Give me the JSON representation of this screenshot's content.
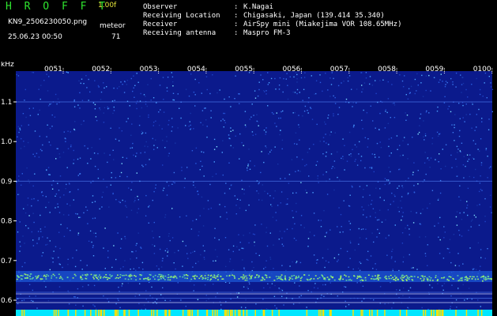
{
  "header": {
    "app_title": "H R O F F T",
    "version": "1.00f",
    "filename": "KN9_2506230050.png",
    "datetime": "25.06.23 00:50",
    "meteor_label": "meteor",
    "meteor_count": "71",
    "info": [
      {
        "key": "Observer",
        "value": "K.Nagai"
      },
      {
        "key": "Receiving Location",
        "value": "Chigasaki, Japan (139.414 35.340)"
      },
      {
        "key": "Receiver",
        "value": "AirSpy mini (Miakejima VOR 108.65MHz)"
      },
      {
        "key": "Receiving antenna",
        "value": "Maspro FM-3"
      }
    ],
    "separator": ":"
  },
  "spectrogram": {
    "unit_label": "kHz",
    "freq_ticks": [
      "1.1",
      "1.0",
      "0.9",
      "0.8",
      "0.7",
      "0.6"
    ],
    "time_ticks": [
      "0051",
      "0052",
      "0053",
      "0054",
      "0055",
      "0056",
      "0057",
      "0058",
      "0059",
      "0100"
    ],
    "colors": {
      "background": "#000000",
      "plot_bg": "#0b1a8c",
      "noise": "#1f44c8",
      "signal": "#9ff06a",
      "text": "#ffffff",
      "title": "#2fe42f",
      "bottom_bar": "#00e6ff",
      "bottom_ticks": "#ffe000"
    }
  }
}
